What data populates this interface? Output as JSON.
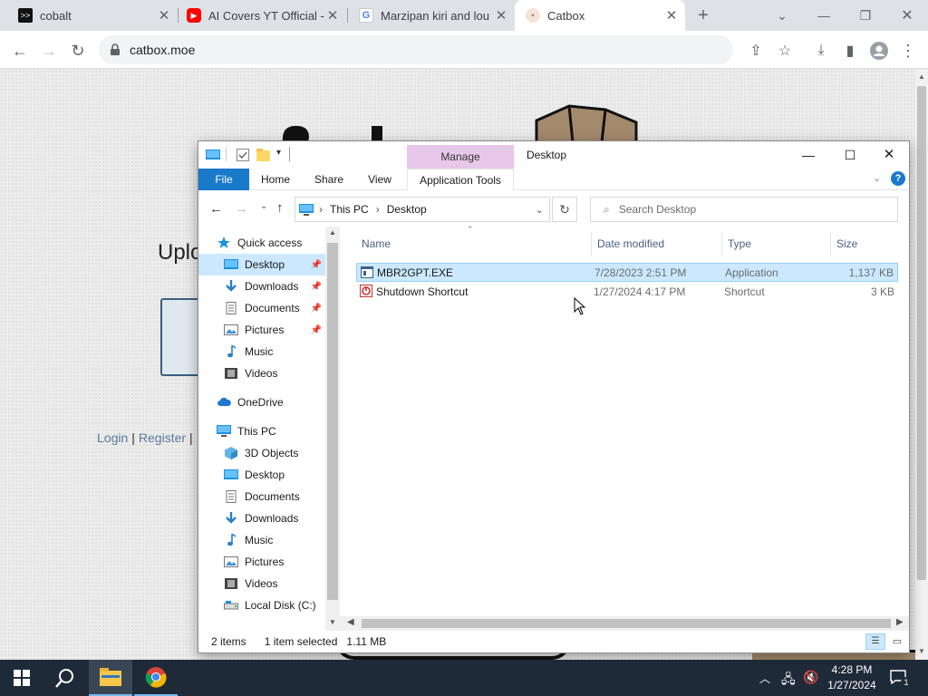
{
  "browser": {
    "tabs": [
      {
        "title": "cobalt",
        "favicon": "cobalt-icon"
      },
      {
        "title": "AI Covers YT Official - Y",
        "favicon": "youtube-icon"
      },
      {
        "title": "Marzipan kiri and lou -",
        "favicon": "google-icon"
      },
      {
        "title": "Catbox",
        "favicon": "catbox-icon"
      }
    ],
    "url": "catbox.moe"
  },
  "catbox_page": {
    "upload_heading": "Uplo",
    "login_link": "Login",
    "sep": "|",
    "register_link": "Register",
    "sep2": "|"
  },
  "explorer": {
    "window_title": "Desktop",
    "contextual_group": "Manage",
    "ribbon_tabs": [
      "File",
      "Home",
      "Share",
      "View",
      "Application Tools"
    ],
    "breadcrumb": [
      "This PC",
      "Desktop"
    ],
    "search_placeholder": "Search Desktop",
    "nav_items": [
      {
        "label": "Quick access",
        "icon": "star-icon",
        "pinned": false
      },
      {
        "label": "Desktop",
        "icon": "desktop-icon",
        "pinned": true
      },
      {
        "label": "Downloads",
        "icon": "download-icon",
        "pinned": true
      },
      {
        "label": "Documents",
        "icon": "document-icon",
        "pinned": true
      },
      {
        "label": "Pictures",
        "icon": "picture-icon",
        "pinned": true
      },
      {
        "label": "Music",
        "icon": "music-icon",
        "pinned": false
      },
      {
        "label": "Videos",
        "icon": "video-icon",
        "pinned": false
      },
      {
        "label": "OneDrive",
        "icon": "cloud-icon",
        "pinned": false
      },
      {
        "label": "This PC",
        "icon": "computer-icon",
        "pinned": false
      },
      {
        "label": "3D Objects",
        "icon": "cube-icon",
        "pinned": false
      },
      {
        "label": "Desktop",
        "icon": "desktop-icon",
        "pinned": false
      },
      {
        "label": "Documents",
        "icon": "document-icon",
        "pinned": false
      },
      {
        "label": "Downloads",
        "icon": "download-icon",
        "pinned": false
      },
      {
        "label": "Music",
        "icon": "music-icon",
        "pinned": false
      },
      {
        "label": "Pictures",
        "icon": "picture-icon",
        "pinned": false
      },
      {
        "label": "Videos",
        "icon": "video-icon",
        "pinned": false
      },
      {
        "label": "Local Disk (C:)",
        "icon": "drive-icon",
        "pinned": false
      }
    ],
    "columns": [
      "Name",
      "Date modified",
      "Type",
      "Size"
    ],
    "files": [
      {
        "name": "MBR2GPT.EXE",
        "date": "7/28/2023 2:51 PM",
        "type": "Application",
        "size": "1,137 KB",
        "selected": true,
        "icon": "exe-icon"
      },
      {
        "name": "Shutdown Shortcut",
        "date": "1/27/2024 4:17 PM",
        "type": "Shortcut",
        "size": "3 KB",
        "selected": false,
        "icon": "shortcut-icon"
      }
    ],
    "status": {
      "items": "2 items",
      "selected": "1 item selected",
      "size": "1.11 MB"
    }
  },
  "taskbar": {
    "time": "4:28 PM",
    "date": "1/27/2024",
    "notifications": "1"
  },
  "colors": {
    "selection": "#cce8ff",
    "selection_border": "#99d1ff",
    "manage_bg": "#e8c8ea",
    "file_tab": "#1979ca",
    "taskbar": "#1f2a39"
  }
}
